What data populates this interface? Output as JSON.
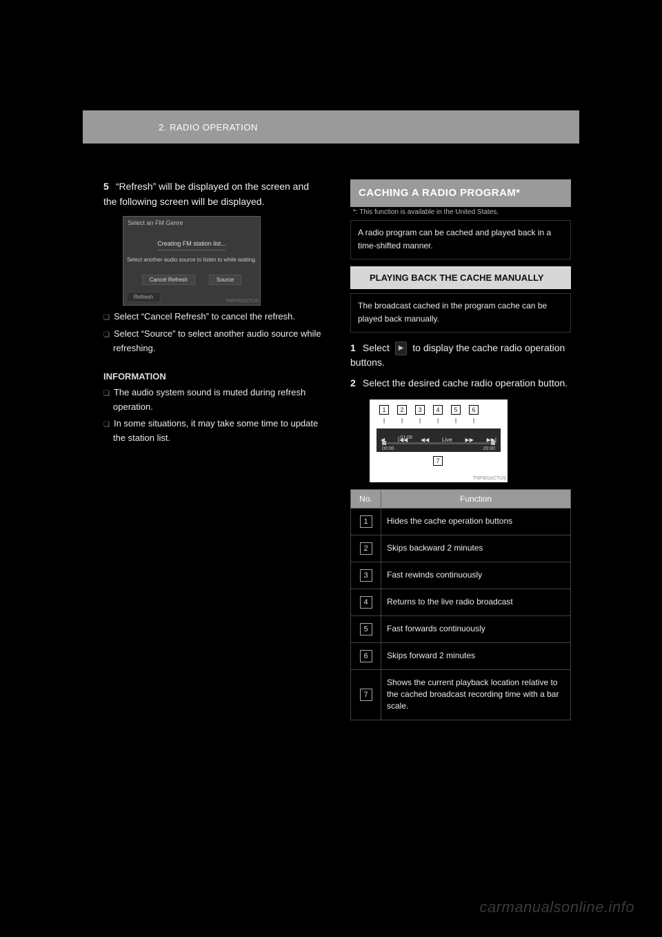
{
  "header": {
    "section_label": "2. RADIO OPERATION"
  },
  "left": {
    "step5_num": "5",
    "step5_text": "“Refresh” will be displayed on the screen and the following screen will be displayed.",
    "shot1": {
      "title": "Select an FM Genre",
      "msg1": "Creating FM station list...",
      "msg2": "Select another audio source to listen to while waiting.",
      "btn_cancel": "Cancel Refresh",
      "btn_source": "Source",
      "refresh_tab": "Refresh",
      "tag": "TNF002cCTUS"
    },
    "note1": "Select “Cancel Refresh” to cancel the refresh.",
    "note2": "Select “Source” to select another audio source while refreshing.",
    "info_heading": "INFORMATION",
    "info_b1": "The audio system sound is muted during refresh operation.",
    "info_b2": "In some situations, it may take some time to update the station list."
  },
  "right": {
    "panel_title": "CACHING A RADIO PROGRAM*",
    "asterisk_note": "*: This function is available in the United States.",
    "framed1": "A radio program can be cached and played back in a time-shifted manner.",
    "sub_panel_title": "PLAYING BACK THE CACHE MANUALLY",
    "framed2": "The broadcast cached in the program cache can be played back manually.",
    "step1_num": "1",
    "step1_text_a": "Select ",
    "step1_text_b": " to display the cache radio operation buttons.",
    "step2_num": "2",
    "step2_text": "Select the desired cache radio operation button.",
    "shot2": {
      "labels": [
        "1",
        "2",
        "3",
        "4",
        "5",
        "6"
      ],
      "btn_prev": "|◀◀",
      "btn_rw": "◀◀",
      "btn_live": "Live",
      "btn_ff": "▶▶",
      "btn_next": "▶▶|",
      "t_neg": "-01:08",
      "t_start": "00:00",
      "t_end": "20:00",
      "label7": "7",
      "tag": "TNF001eCTUS"
    },
    "table": {
      "col_no": "No.",
      "col_fn": "Function",
      "rows": [
        {
          "n": "1",
          "fn": "Hides the cache operation buttons"
        },
        {
          "n": "2",
          "fn": "Skips backward 2 minutes"
        },
        {
          "n": "3",
          "fn": "Fast rewinds continuously"
        },
        {
          "n": "4",
          "fn": "Returns to the live radio broadcast"
        },
        {
          "n": "5",
          "fn": "Fast forwards continuously"
        },
        {
          "n": "6",
          "fn": "Skips forward 2 minutes"
        },
        {
          "n": "7",
          "fn": "Shows the current playback location relative to the cached broadcast recording time with a bar scale."
        }
      ]
    }
  },
  "watermark": "carmanualsonline.info"
}
